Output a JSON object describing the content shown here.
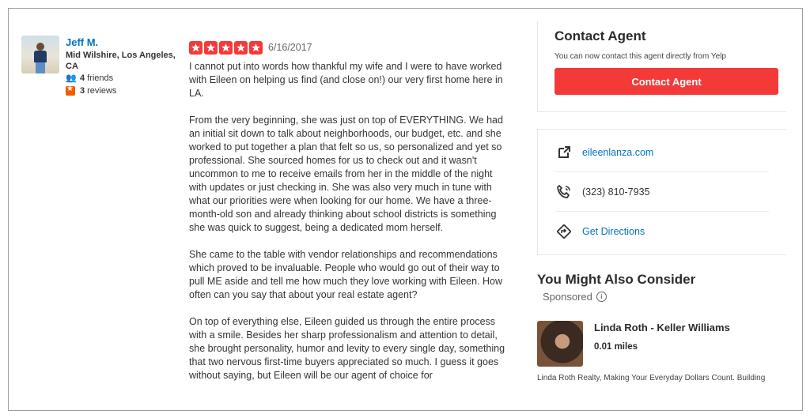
{
  "reviewer": {
    "name": "Jeff M.",
    "location": "Mid Wilshire, Los Angeles, CA",
    "friends_count": "4",
    "friends_label": "friends",
    "reviews_count": "3",
    "reviews_label": "reviews"
  },
  "review": {
    "rating": 5,
    "date": "6/16/2017",
    "paragraphs": [
      "I cannot put into words how thankful my wife and I were to have worked with Eileen on helping us find (and close on!) our very first home here in LA.",
      "From the very beginning, she was just on top of EVERYTHING. We had an initial sit down to talk about neighborhoods, our budget, etc. and she worked to put together a plan that felt so us, so personalized and yet so professional. She sourced homes for us to check out and it wasn't uncommon to me to receive emails from her in the middle of the night with updates or just checking in. She was also very much in tune with what our priorities were when looking for our home. We have a three-month-old son and already thinking about school districts is something she was quick to suggest, being a dedicated mom herself.",
      "She came to the table with vendor relationships and recommendations which proved to be invaluable. People who would go out of their way to pull ME aside and tell me how much they love working with Eileen. How often can you say that about your real estate agent?",
      "On top of everything else, Eileen guided us through the entire process with a smile. Besides her sharp professionalism and attention to detail, she brought personality, humor and levity to every single day, something that two nervous first-time buyers appreciated so much. I guess it goes without saying, but Eileen will be our agent of choice for"
    ]
  },
  "contact": {
    "title": "Contact Agent",
    "subtitle": "You can now contact this agent directly from Yelp",
    "button_label": "Contact Agent"
  },
  "business_info": {
    "website": "eileenlanza.com",
    "phone": "(323) 810-7935",
    "directions": "Get Directions"
  },
  "consider": {
    "title": "You Might Also Consider",
    "sponsored_label": "Sponsored",
    "ad": {
      "name": "Linda Roth - Keller Williams",
      "distance": "0.01 miles",
      "description": "Linda Roth Realty, Making Your Everyday Dollars Count. Building"
    }
  },
  "colors": {
    "brand_red": "#f43939",
    "link_blue": "#0073bb",
    "orange": "#f15c00"
  },
  "icons": {
    "website": "external-link-icon",
    "phone": "phone-icon",
    "directions": "directions-icon",
    "info": "info-icon",
    "star": "star-icon"
  }
}
